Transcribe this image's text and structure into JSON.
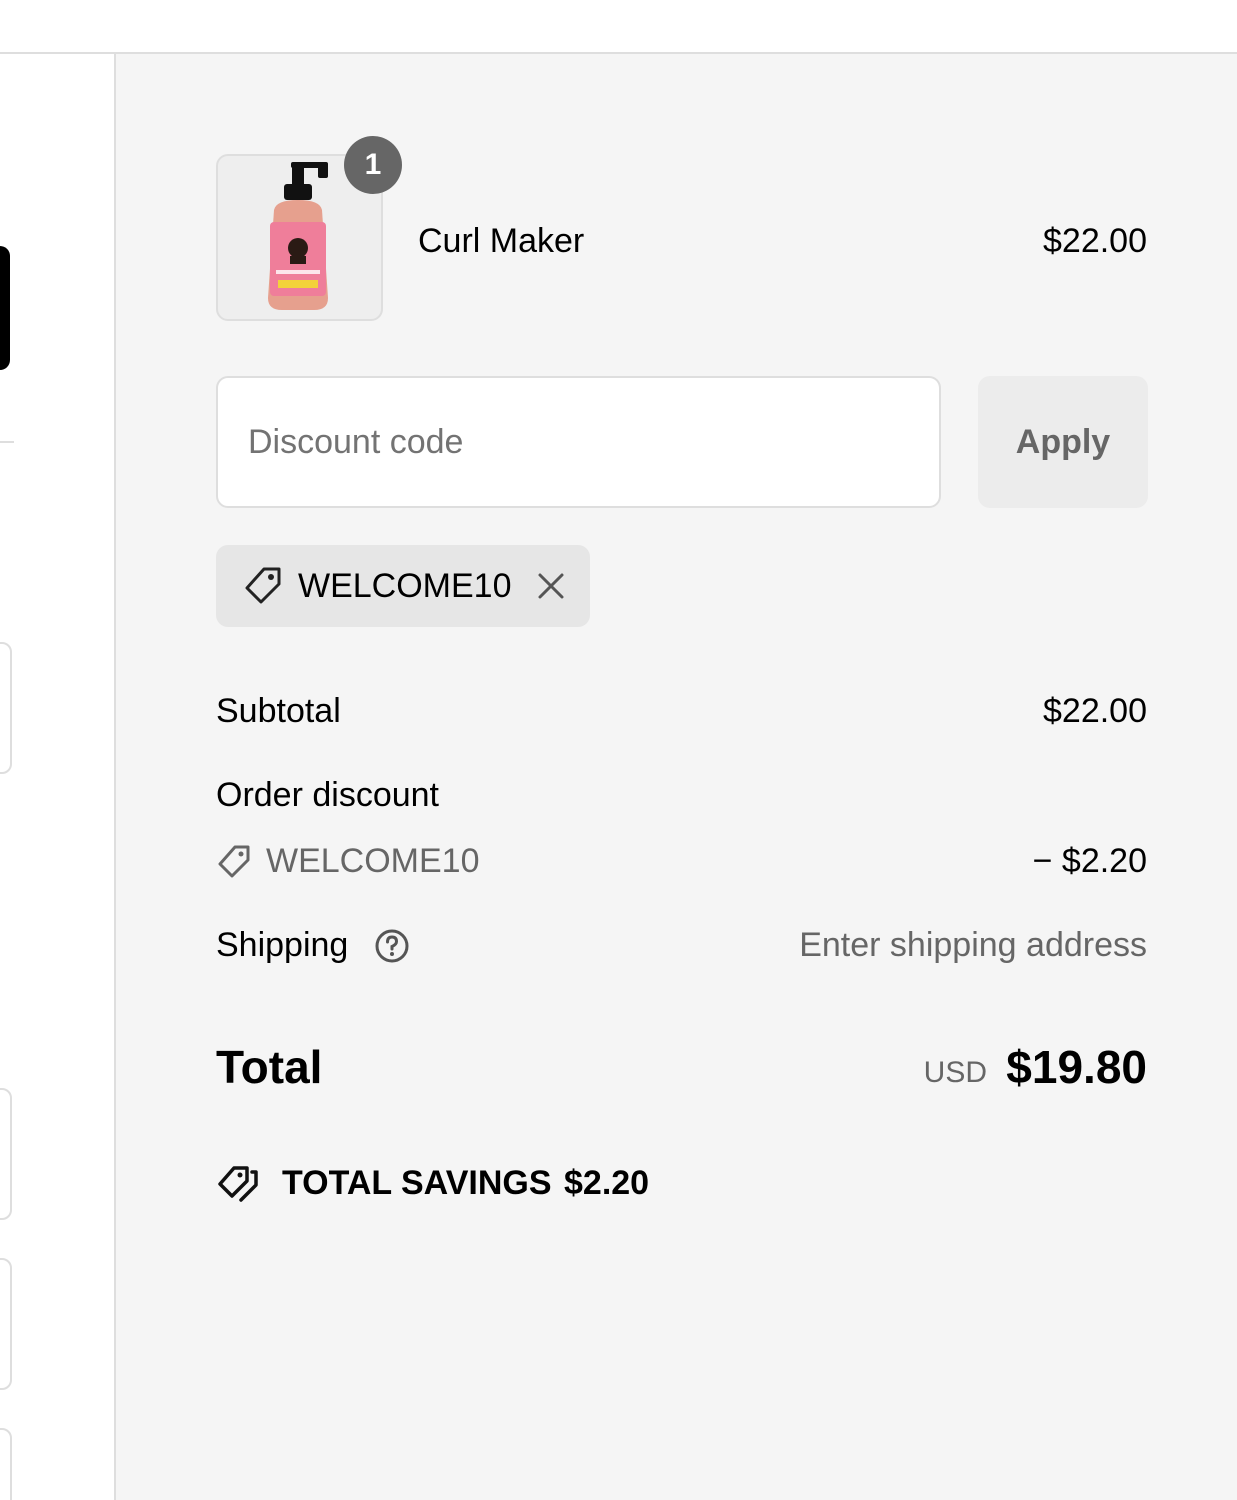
{
  "order_summary": {
    "item": {
      "name": "Curl Maker",
      "price": "$22.00",
      "quantity": "1",
      "image_icon": "product-bottle-image"
    },
    "discount": {
      "placeholder": "Discount code",
      "apply_label": "Apply",
      "applied_code": "WELCOME10"
    },
    "subtotal": {
      "label": "Subtotal",
      "value": "$22.00"
    },
    "order_discount": {
      "label": "Order discount",
      "code": "WELCOME10",
      "value": "− $2.20"
    },
    "shipping": {
      "label": "Shipping",
      "value": "Enter shipping address"
    },
    "total": {
      "label": "Total",
      "currency": "USD",
      "value": "$19.80"
    },
    "savings": {
      "label": "TOTAL SAVINGS",
      "value": "$2.20"
    }
  },
  "colors": {
    "summary_bg": "#f5f5f5",
    "border": "#dedede",
    "muted_text": "#666666",
    "badge_bg": "#666666",
    "link": "#1f73b7"
  },
  "icons": [
    "tag-icon",
    "close-icon",
    "help-icon",
    "savings-tag-icon"
  ]
}
